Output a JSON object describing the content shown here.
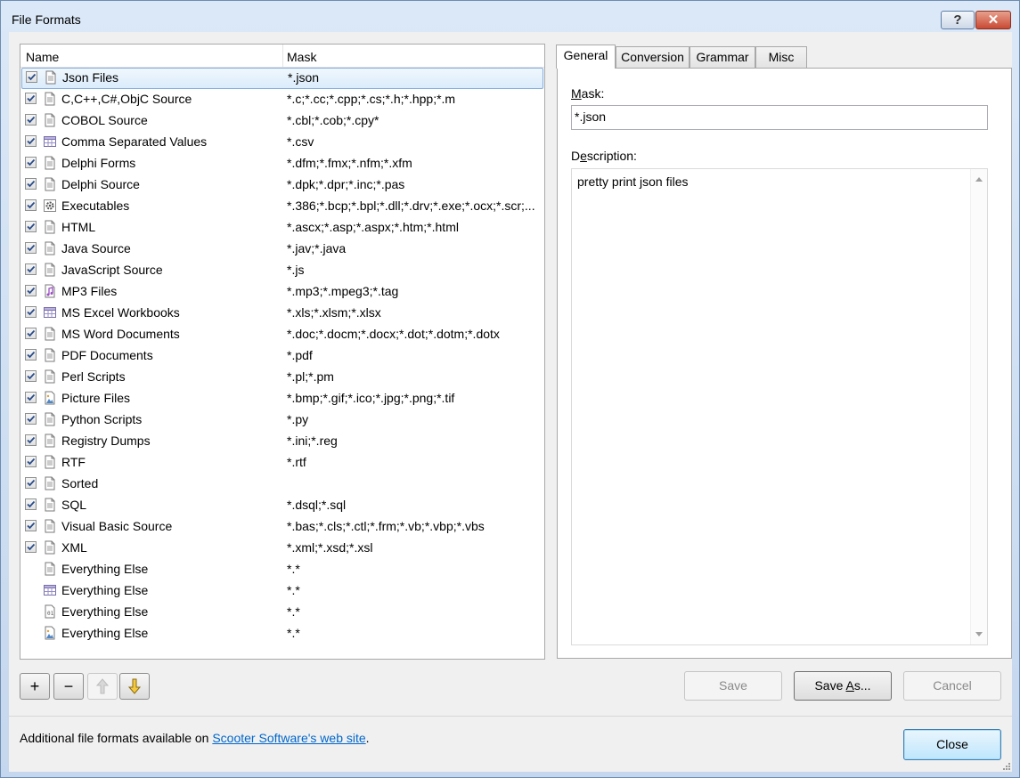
{
  "window": {
    "title": "File Formats",
    "help_label": "?",
    "close_label": "✕"
  },
  "list": {
    "columns": {
      "name": "Name",
      "mask": "Mask"
    },
    "rows": [
      {
        "name": "Json Files",
        "mask": "*.json",
        "checked": true,
        "icon": "document-icon",
        "selected": true
      },
      {
        "name": "C,C++,C#,ObjC Source",
        "mask": "*.c;*.cc;*.cpp;*.cs;*.h;*.hpp;*.m",
        "checked": true,
        "icon": "document-icon"
      },
      {
        "name": "COBOL Source",
        "mask": "*.cbl;*.cob;*.cpy*",
        "checked": true,
        "icon": "document-icon"
      },
      {
        "name": "Comma Separated Values",
        "mask": "*.csv",
        "checked": true,
        "icon": "table-icon"
      },
      {
        "name": "Delphi Forms",
        "mask": "*.dfm;*.fmx;*.nfm;*.xfm",
        "checked": true,
        "icon": "document-icon"
      },
      {
        "name": "Delphi Source",
        "mask": "*.dpk;*.dpr;*.inc;*.pas",
        "checked": true,
        "icon": "document-icon"
      },
      {
        "name": "Executables",
        "mask": "*.386;*.bcp;*.bpl;*.dll;*.drv;*.exe;*.ocx;*.scr;...",
        "checked": true,
        "icon": "gear-icon"
      },
      {
        "name": "HTML",
        "mask": "*.ascx;*.asp;*.aspx;*.htm;*.html",
        "checked": true,
        "icon": "document-icon"
      },
      {
        "name": "Java Source",
        "mask": "*.jav;*.java",
        "checked": true,
        "icon": "document-icon"
      },
      {
        "name": "JavaScript Source",
        "mask": "*.js",
        "checked": true,
        "icon": "document-icon"
      },
      {
        "name": "MP3 Files",
        "mask": "*.mp3;*.mpeg3;*.tag",
        "checked": true,
        "icon": "music-note-icon"
      },
      {
        "name": "MS Excel Workbooks",
        "mask": "*.xls;*.xlsm;*.xlsx",
        "checked": true,
        "icon": "table-icon"
      },
      {
        "name": "MS Word Documents",
        "mask": "*.doc;*.docm;*.docx;*.dot;*.dotm;*.dotx",
        "checked": true,
        "icon": "document-icon"
      },
      {
        "name": "PDF Documents",
        "mask": "*.pdf",
        "checked": true,
        "icon": "document-icon"
      },
      {
        "name": "Perl Scripts",
        "mask": "*.pl;*.pm",
        "checked": true,
        "icon": "document-icon"
      },
      {
        "name": "Picture Files",
        "mask": "*.bmp;*.gif;*.ico;*.jpg;*.png;*.tif",
        "checked": true,
        "icon": "picture-icon"
      },
      {
        "name": "Python Scripts",
        "mask": "*.py",
        "checked": true,
        "icon": "document-icon"
      },
      {
        "name": "Registry Dumps",
        "mask": "*.ini;*.reg",
        "checked": true,
        "icon": "document-icon"
      },
      {
        "name": "RTF",
        "mask": "*.rtf",
        "checked": true,
        "icon": "document-icon"
      },
      {
        "name": "Sorted",
        "mask": "",
        "checked": true,
        "icon": "document-icon"
      },
      {
        "name": "SQL",
        "mask": "*.dsql;*.sql",
        "checked": true,
        "icon": "document-icon"
      },
      {
        "name": "Visual Basic Source",
        "mask": "*.bas;*.cls;*.ctl;*.frm;*.vb;*.vbp;*.vbs",
        "checked": true,
        "icon": "document-icon"
      },
      {
        "name": "XML",
        "mask": "*.xml;*.xsd;*.xsl",
        "checked": true,
        "icon": "document-icon"
      },
      {
        "name": "Everything Else",
        "mask": "*.*",
        "checked": false,
        "icon": "document-icon"
      },
      {
        "name": "Everything Else",
        "mask": "*.*",
        "checked": false,
        "icon": "table-icon"
      },
      {
        "name": "Everything Else",
        "mask": "*.*",
        "checked": false,
        "icon": "binary-file-icon"
      },
      {
        "name": "Everything Else",
        "mask": "*.*",
        "checked": false,
        "icon": "picture-icon"
      }
    ]
  },
  "toolbar": {
    "add_label": "+",
    "remove_label": "−"
  },
  "tabs": [
    {
      "label": "General",
      "active": true
    },
    {
      "label": "Conversion",
      "active": false
    },
    {
      "label": "Grammar",
      "active": false
    },
    {
      "label": "Misc",
      "active": false
    }
  ],
  "general": {
    "mask_label_hotkey": "M",
    "mask_label_rest": "ask:",
    "mask_value": "*.json",
    "description_label_pre": "D",
    "description_label_hotkey": "e",
    "description_label_rest": "scription:",
    "description_value": "pretty print json files"
  },
  "buttons": {
    "save": "Save",
    "save_as_pre": "Save ",
    "save_as_hotkey": "A",
    "save_as_rest": "s...",
    "cancel": "Cancel",
    "close": "Close"
  },
  "footer": {
    "text_before": "Additional file formats available on ",
    "link": "Scooter Software's web site",
    "text_after": "."
  },
  "colors": {
    "link": "#0066cc",
    "selection_border": "#84acdd",
    "title_gradient_top": "#dbe8f7"
  }
}
